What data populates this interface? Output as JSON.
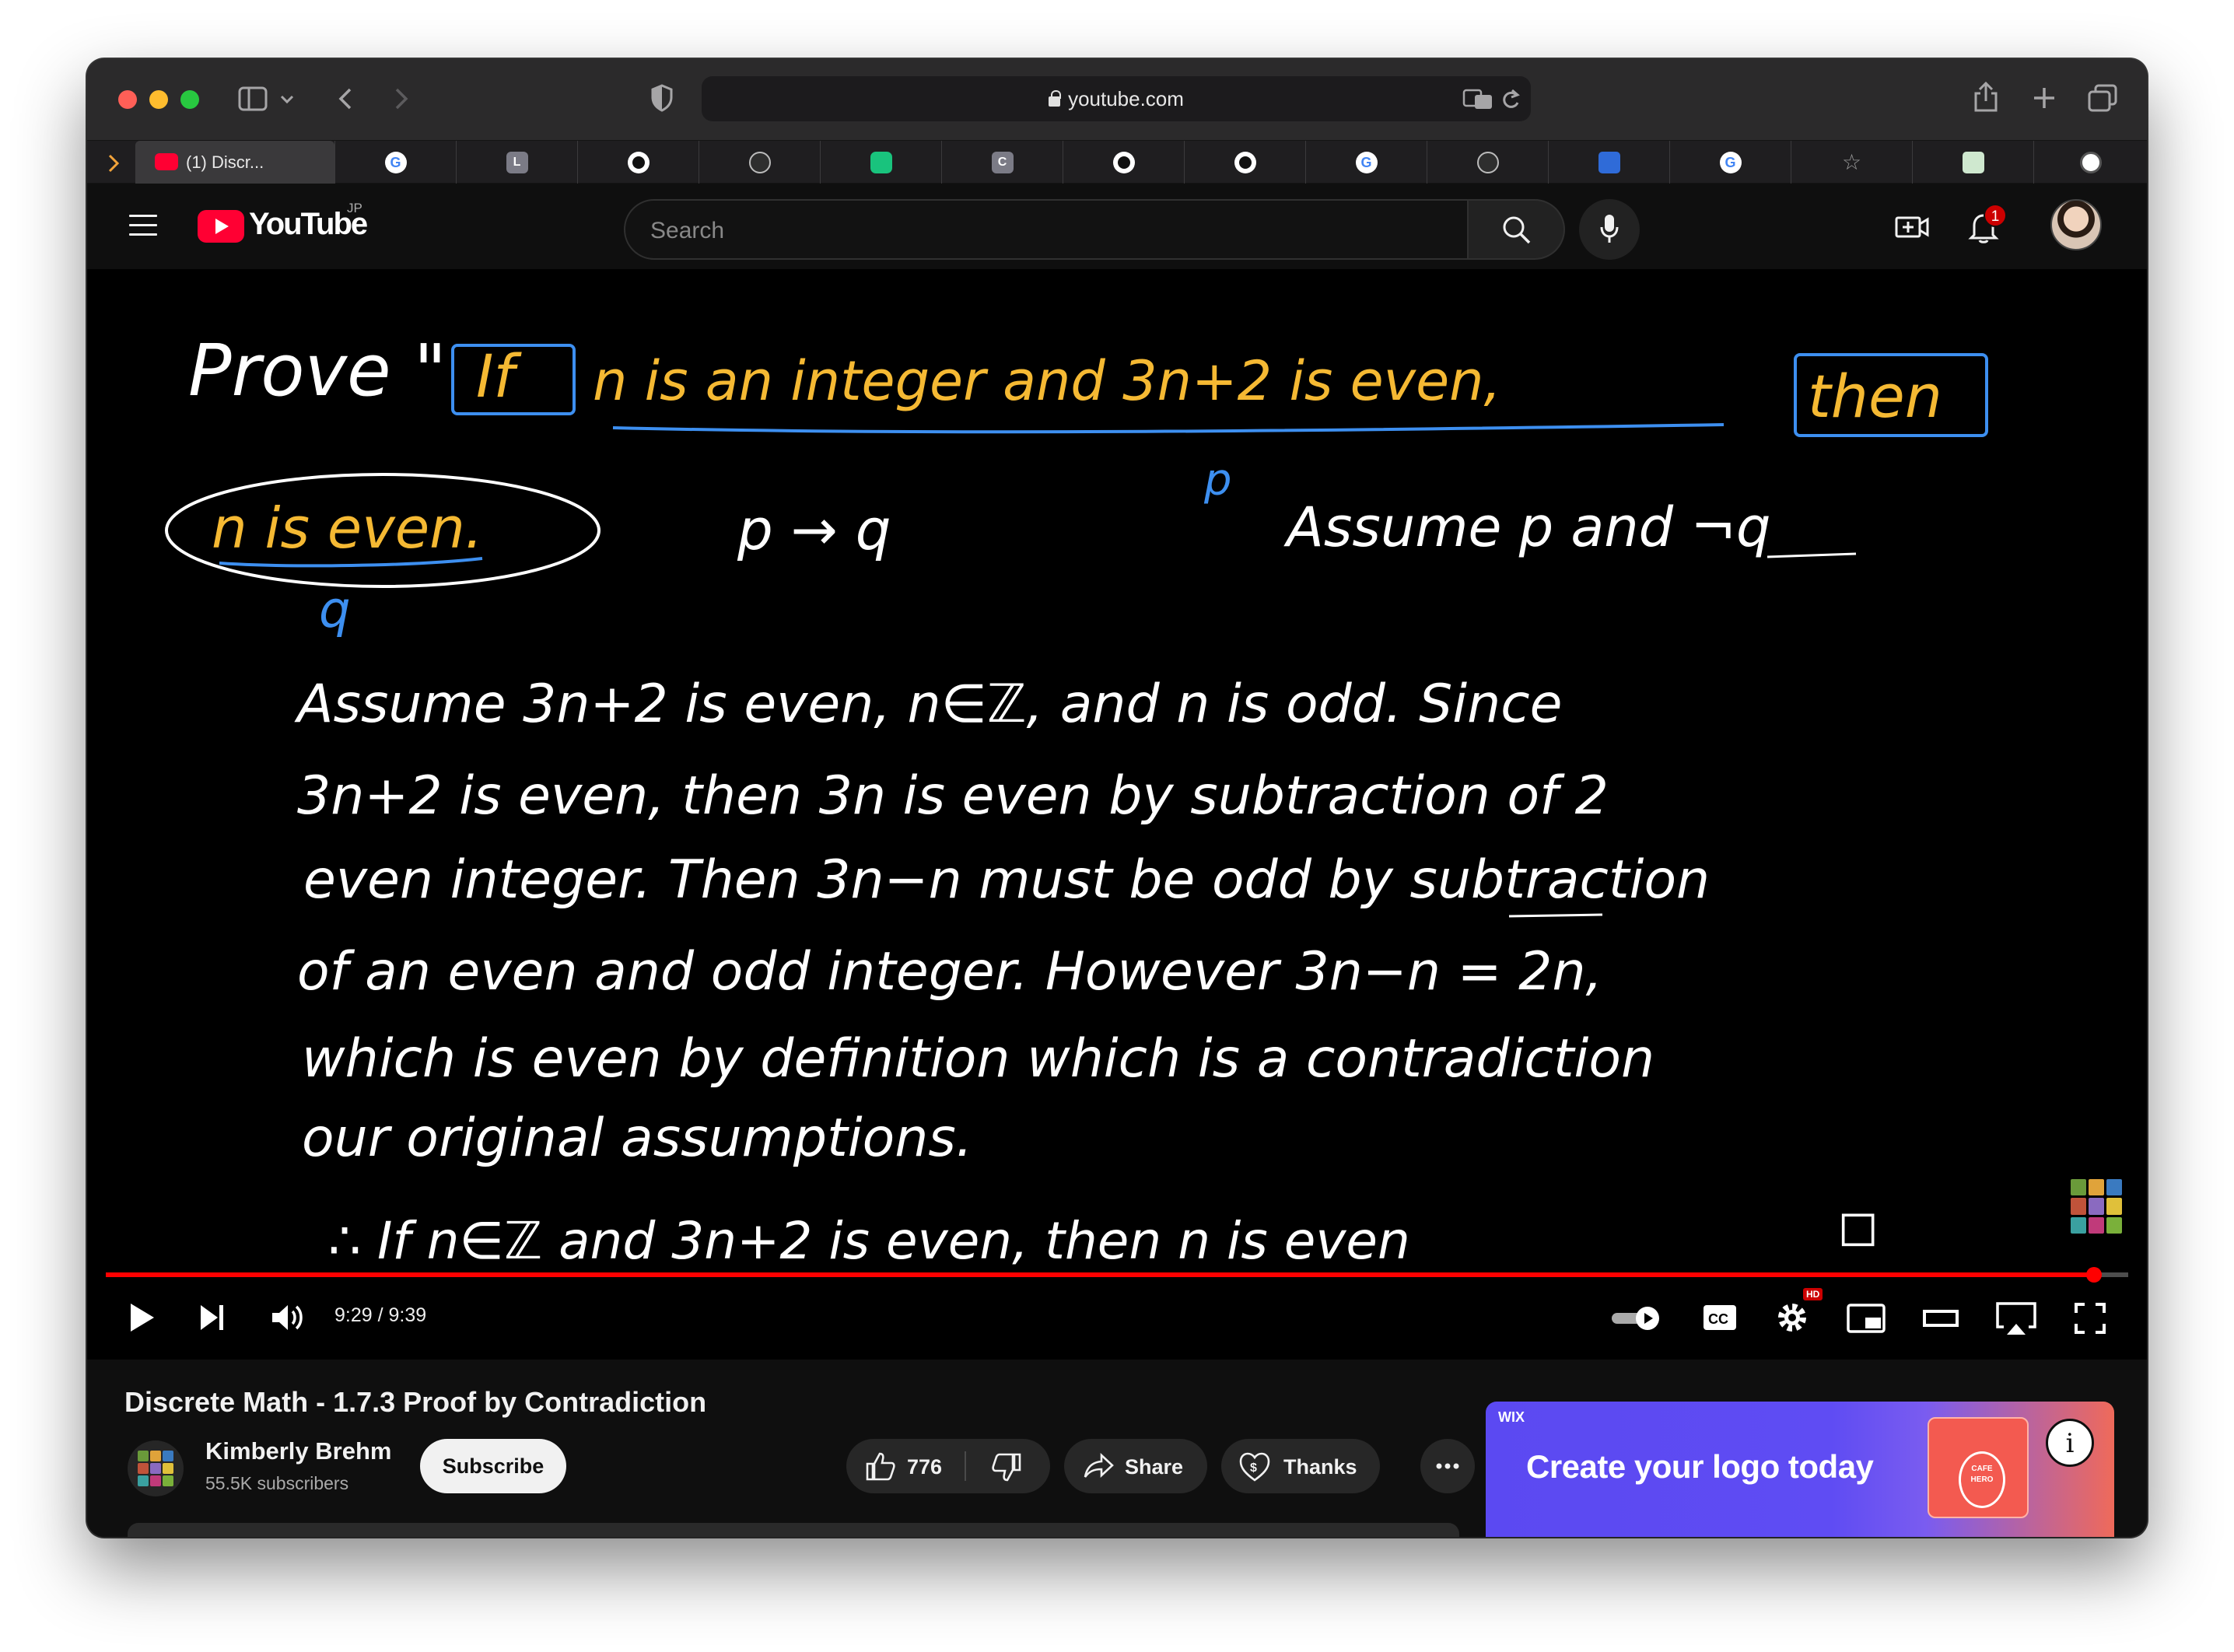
{
  "browser": {
    "url": "youtube.com",
    "active_tab_title": "(1) Discr..."
  },
  "youtube": {
    "logo_text": "YouTube",
    "region": "JP",
    "search_placeholder": "Search",
    "notification_count": "1"
  },
  "video": {
    "time": "9:29 / 9:39",
    "progress": 0.983,
    "hd_badge": "HD",
    "board_text": {
      "prove": "Prove \"",
      "if": "If",
      "hypothesis": "n is an integer and 3n+2 is even,",
      "then": "then",
      "conclusion": "n is even.",
      "q_label": "q",
      "p_label": "p",
      "p_implies_q": "p → q",
      "assume_line": "Assume p and ¬q",
      "para": [
        "Assume 3n+2 is even, n∈ℤ, and n is odd. Since",
        "3n+2 is even, then 3n is even by subtraction of 2",
        "even integer. Then 3n−n must be odd by subtraction",
        "of an even and odd integer. However 3n−n = 2n,",
        "which is even by definition which is a contradiction",
        "our original assumptions."
      ],
      "conclusion_line": "∴ If n∈ℤ and 3n+2 is even, then n is even",
      "qed": "◻"
    }
  },
  "info": {
    "title": "Discrete Math - 1.7.3 Proof by Contradiction",
    "channel_name": "Kimberly Brehm",
    "subscribers": "55.5K subscribers",
    "subscribe_label": "Subscribe",
    "likes": "776",
    "share_label": "Share",
    "thanks_label": "Thanks"
  },
  "ad": {
    "brand": "WIX",
    "headline": "Create your logo today",
    "card_text": "CAFE HERO"
  },
  "colors": {
    "board_chalk": "#ffffff",
    "board_highlight": "#f5b933",
    "board_blue": "#3d8ff0",
    "yt_red": "#ff0033",
    "progress_red": "#ff0000"
  }
}
